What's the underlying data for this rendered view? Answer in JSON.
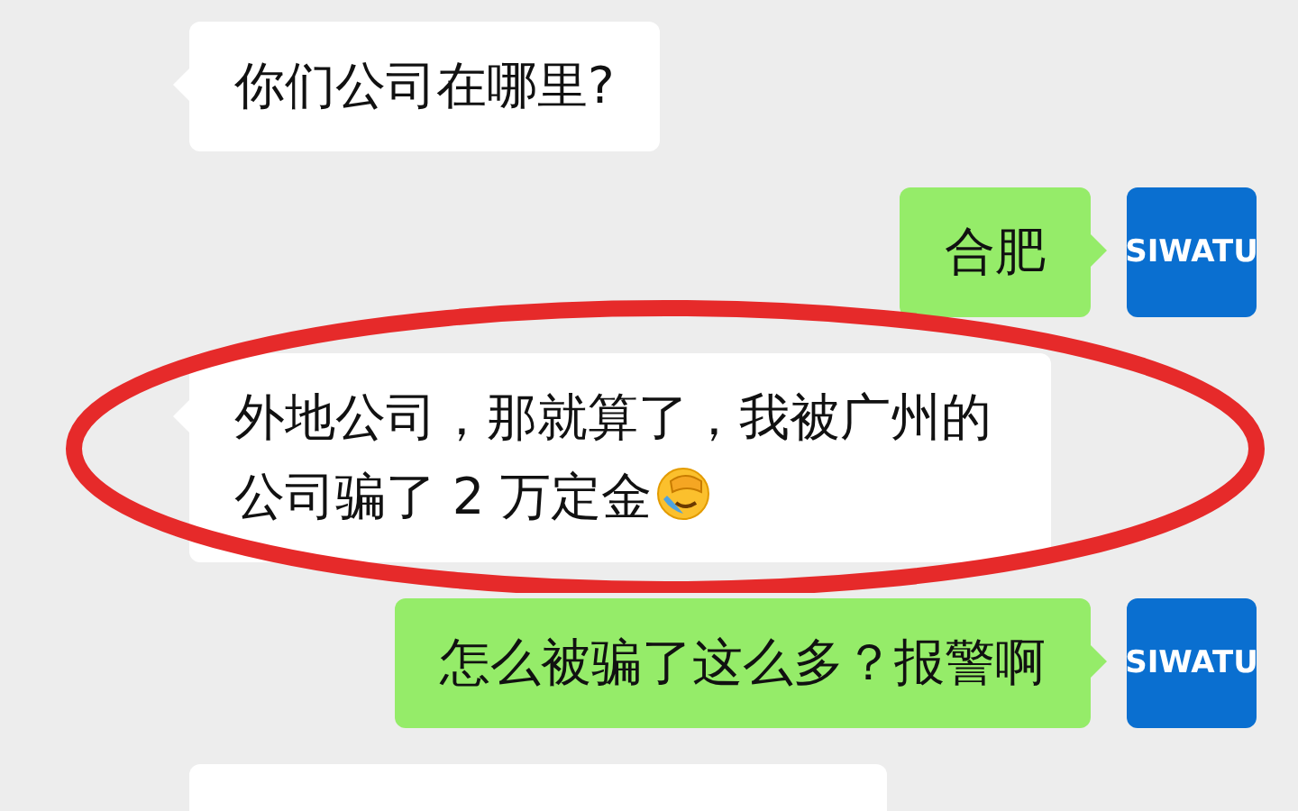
{
  "messages": [
    {
      "outgoing": false,
      "text": "你们公司在哪里?"
    },
    {
      "outgoing": true,
      "text": "合肥",
      "avatar": "SIWATU"
    },
    {
      "outgoing": false,
      "text": "外地公司，那就算了，我被广州的公司骗了 2 万定金",
      "emoji": true,
      "highlighted": true
    },
    {
      "outgoing": true,
      "text": "怎么被骗了这么多？报警啊",
      "avatar": "SIWATU"
    },
    {
      "outgoing": false
    }
  ]
}
